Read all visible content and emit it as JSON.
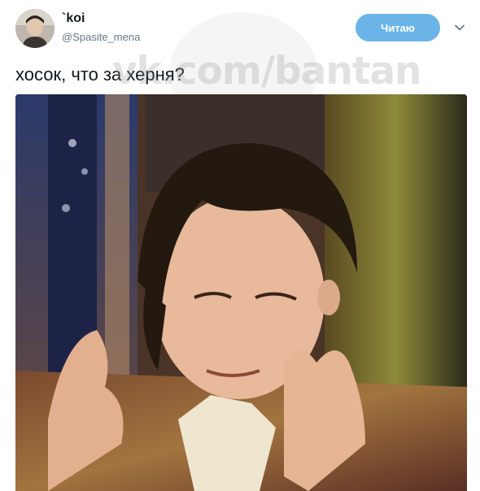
{
  "tweet": {
    "author_name": "`koi",
    "author_handle": "@Spasite_mena",
    "follow_label": "Читаю",
    "text": "хосок, что за херня?"
  },
  "watermark": {
    "text": "vk.com/bantan"
  },
  "icons": {
    "menu": "chevron-down-icon"
  },
  "colors": {
    "follow_button": "#6ab4e8",
    "handle_text": "#657786",
    "text": "#14171a"
  }
}
